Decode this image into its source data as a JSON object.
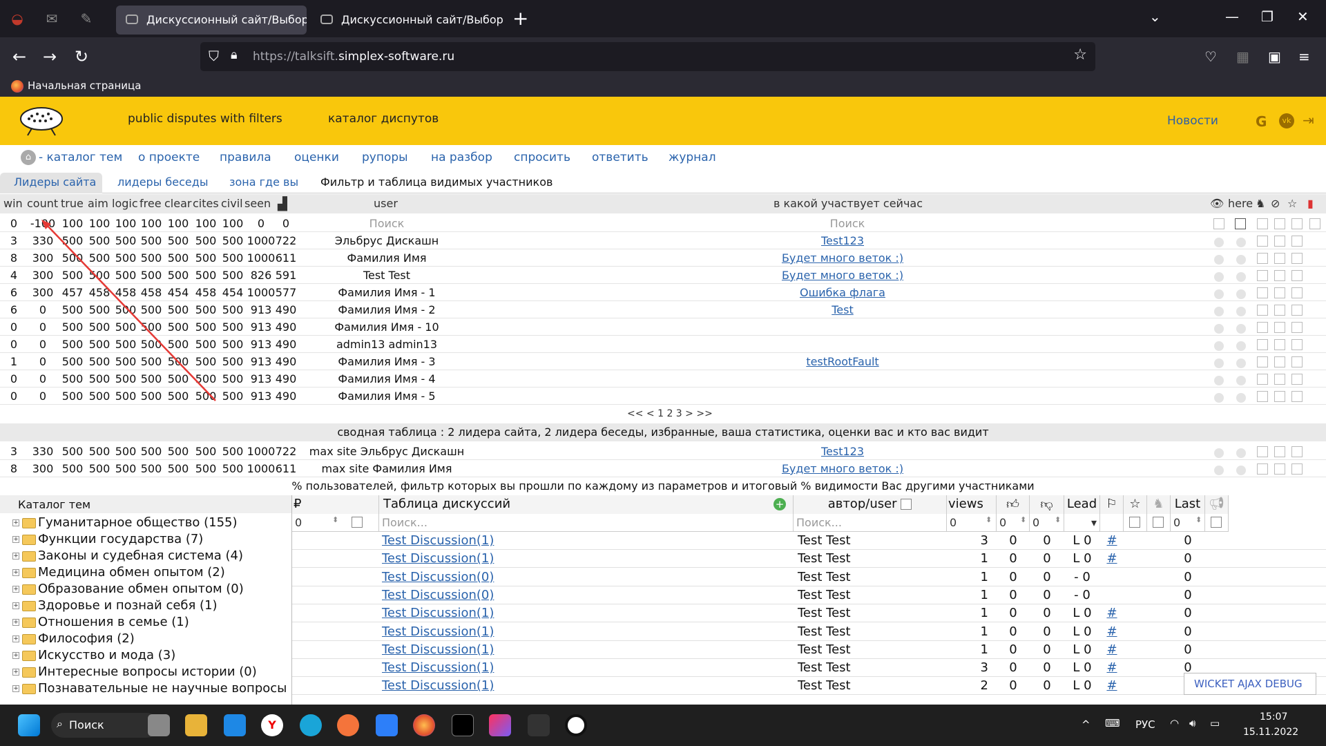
{
  "browser": {
    "tabs": [
      {
        "title": "Дискуссионный сайт/Выбор т"
      },
      {
        "title": "Дискуссионный сайт/Выбор т"
      }
    ],
    "url_host": "https://talksift.",
    "url_domain": "simplex-software.ru",
    "bookmark": "Начальная страница"
  },
  "site": {
    "tagline": "public disputes with filters",
    "catalog": "каталог диспутов",
    "news": "Новости"
  },
  "menu": [
    "- каталог тем",
    "о проекте",
    "правила",
    "оценки",
    "рупоры",
    "на разбор",
    "спросить",
    "ответить",
    "журнал"
  ],
  "subtabs": [
    "Лидеры сайта",
    "лидеры беседы",
    "зона где вы",
    "Фильтр и таблица видимых участников"
  ],
  "headers": {
    "cols": [
      "win",
      "count",
      "true",
      "aim",
      "logic",
      "free",
      "clear",
      "cites",
      "civil",
      "seen"
    ],
    "user": "user",
    "discussion": "в какой участвует сейчас",
    "here": "here"
  },
  "filter_row": {
    "vals": [
      "0",
      "-100",
      "100",
      "100",
      "100",
      "100",
      "100",
      "100",
      "100",
      "0",
      "0"
    ],
    "user_ph": "Поиск",
    "disc_ph": "Поиск"
  },
  "rows": [
    {
      "v": [
        "3",
        "330",
        "500",
        "500",
        "500",
        "500",
        "500",
        "500",
        "500",
        "1000",
        "722"
      ],
      "user": "Эльбрус Дискашн",
      "disc": "Test123"
    },
    {
      "v": [
        "8",
        "300",
        "500",
        "500",
        "500",
        "500",
        "500",
        "500",
        "500",
        "1000",
        "611"
      ],
      "user": "Фамилия Имя",
      "disc": "Будет много веток :)"
    },
    {
      "v": [
        "4",
        "300",
        "500",
        "500",
        "500",
        "500",
        "500",
        "500",
        "500",
        "826",
        "591"
      ],
      "user": "Test Test",
      "disc": "Будет много веток :)"
    },
    {
      "v": [
        "6",
        "300",
        "457",
        "458",
        "458",
        "458",
        "454",
        "458",
        "454",
        "1000",
        "577"
      ],
      "user": "Фамилия Имя - 1",
      "disc": "Ошибка флага"
    },
    {
      "v": [
        "6",
        "0",
        "500",
        "500",
        "500",
        "500",
        "500",
        "500",
        "500",
        "913",
        "490"
      ],
      "user": "Фамилия Имя - 2",
      "disc": "Test"
    },
    {
      "v": [
        "0",
        "0",
        "500",
        "500",
        "500",
        "500",
        "500",
        "500",
        "500",
        "913",
        "490"
      ],
      "user": "Фамилия Имя - 10",
      "disc": ""
    },
    {
      "v": [
        "0",
        "0",
        "500",
        "500",
        "500",
        "500",
        "500",
        "500",
        "500",
        "913",
        "490"
      ],
      "user": "admin13 admin13",
      "disc": ""
    },
    {
      "v": [
        "1",
        "0",
        "500",
        "500",
        "500",
        "500",
        "500",
        "500",
        "500",
        "913",
        "490"
      ],
      "user": "Фамилия Имя - 3",
      "disc": "testRootFault"
    },
    {
      "v": [
        "0",
        "0",
        "500",
        "500",
        "500",
        "500",
        "500",
        "500",
        "500",
        "913",
        "490"
      ],
      "user": "Фамилия Имя - 4",
      "disc": ""
    },
    {
      "v": [
        "0",
        "0",
        "500",
        "500",
        "500",
        "500",
        "500",
        "500",
        "500",
        "913",
        "490"
      ],
      "user": "Фамилия Имя - 5",
      "disc": ""
    }
  ],
  "pager": "<<  <  1 2 3  >  >>",
  "summary": "сводная таблица : 2 лидера сайта, 2 лидера беседы, избранные, ваша статистика, оценки вас и кто вас видит",
  "summary_rows": [
    {
      "v": [
        "3",
        "330",
        "500",
        "500",
        "500",
        "500",
        "500",
        "500",
        "500",
        "1000",
        "722"
      ],
      "user": "max site Эльбрус Дискашн",
      "disc": "Test123"
    },
    {
      "v": [
        "8",
        "300",
        "500",
        "500",
        "500",
        "500",
        "500",
        "500",
        "500",
        "1000",
        "611"
      ],
      "user": "max site Фамилия Имя",
      "disc": "Будет много веток :)"
    }
  ],
  "pct_text": "% пользователей, фильтр которых вы прошли по каждому из параметров и итоговый % видимости Вас другими участниками",
  "catalog": {
    "title": "Каталог тем",
    "items": [
      "Гуманитарное общество (155)",
      "Функции государства (7)",
      "Законы и судебная система (4)",
      "Медицина обмен опытом (2)",
      "Образование обмен опытом (0)",
      "Здоровье и познай себя (1)",
      "Отношения в семье (1)",
      "Философия (2)",
      "Искусство и мода (3)",
      "Интересные вопросы истории (0)",
      "Познавательные не научные вопросы"
    ]
  },
  "grid": {
    "h_currency": "₽",
    "h_table": "Таблица дискуссий",
    "h_author": "автор/user",
    "h_views": "views",
    "h_lead": "Lead",
    "h_last": "Last",
    "f_num": "0",
    "f_search": "Поиск...",
    "f_asearch": "Поиск...",
    "f_views": "0",
    "f_up": "0",
    "f_down": "0",
    "f_last": "0",
    "rows": [
      {
        "t": "Test Discussion(1)",
        "a": "Test Test",
        "v": "3",
        "u": "0",
        "d": "0",
        "l": "L 0",
        "h": "#",
        "last": "0"
      },
      {
        "t": "Test Discussion(1)",
        "a": "Test Test",
        "v": "1",
        "u": "0",
        "d": "0",
        "l": "L 0",
        "h": "#",
        "last": "0"
      },
      {
        "t": "Test Discussion(0)",
        "a": "Test Test",
        "v": "1",
        "u": "0",
        "d": "0",
        "l": "- 0",
        "h": "",
        "last": "0"
      },
      {
        "t": "Test Discussion(0)",
        "a": "Test Test",
        "v": "1",
        "u": "0",
        "d": "0",
        "l": "- 0",
        "h": "",
        "last": "0"
      },
      {
        "t": "Test Discussion(1)",
        "a": "Test Test",
        "v": "1",
        "u": "0",
        "d": "0",
        "l": "L 0",
        "h": "#",
        "last": "0"
      },
      {
        "t": "Test Discussion(1)",
        "a": "Test Test",
        "v": "1",
        "u": "0",
        "d": "0",
        "l": "L 0",
        "h": "#",
        "last": "0"
      },
      {
        "t": "Test Discussion(1)",
        "a": "Test Test",
        "v": "1",
        "u": "0",
        "d": "0",
        "l": "L 0",
        "h": "#",
        "last": "0"
      },
      {
        "t": "Test Discussion(1)",
        "a": "Test Test",
        "v": "3",
        "u": "0",
        "d": "0",
        "l": "L 0",
        "h": "#",
        "last": "0"
      },
      {
        "t": "Test Discussion(1)",
        "a": "Test Test",
        "v": "2",
        "u": "0",
        "d": "0",
        "l": "L 0",
        "h": "#",
        "last": "0"
      }
    ]
  },
  "debug": "WICKET AJAX DEBUG",
  "taskbar": {
    "search": "Поиск",
    "lang": "РУС",
    "time": "15:07",
    "date": "15.11.2022"
  }
}
